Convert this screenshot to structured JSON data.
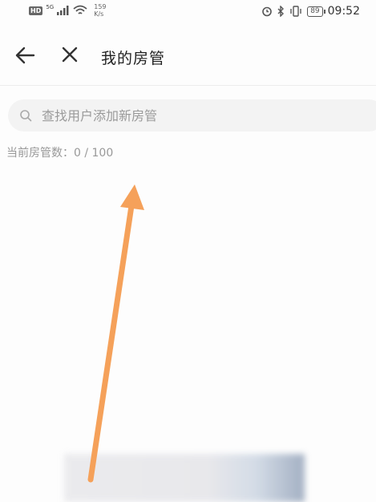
{
  "status_bar": {
    "hd": "HD",
    "signal_label": "5G",
    "speed_value": "159",
    "speed_unit": "K/s",
    "battery": "89",
    "time": "09:52"
  },
  "header": {
    "title": "我的房管"
  },
  "search": {
    "placeholder": "查找用户添加新房管"
  },
  "moderator_count": {
    "label": "当前房管数：",
    "current": "0",
    "max": "100",
    "text": "当前房管数：0 / 100"
  },
  "colors": {
    "annotation_arrow": "#f5a15a",
    "search_bg": "#f3f3f3",
    "muted_text": "#999999"
  }
}
